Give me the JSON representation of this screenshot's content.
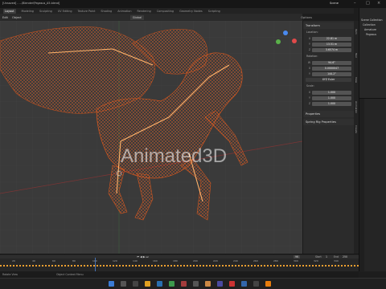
{
  "titlebar": {
    "filename": "[Unsaved] - ...\\Blender\\Pegasus_A5.blend]",
    "scene": "Scene"
  },
  "tabs": [
    "Layout",
    "Modeling",
    "Sculpting",
    "UV Editing",
    "Texture Paint",
    "Shading",
    "Animation",
    "Rendering",
    "Compositing",
    "Geometry Nodes",
    "Scripting"
  ],
  "viewport_header": {
    "mode": "Edit",
    "menu_object": "Object",
    "orientation": "Global"
  },
  "watermark": "Animated3D",
  "npanel": {
    "section_transform": "Transform",
    "location_label": "Location:",
    "location": [
      {
        "axis": "X",
        "value": "22.81 m"
      },
      {
        "axis": "Y",
        "value": "13.51 m"
      },
      {
        "axis": "Z",
        "value": "3.6574 m"
      }
    ],
    "rotation_label": "Rotation:",
    "rotation": [
      {
        "axis": "W",
        "value": "94.6°"
      },
      {
        "axis": "X",
        "value": "0.0000047"
      },
      {
        "axis": "Y",
        "value": "144.2°"
      }
    ],
    "rotation_mode": "XYZ Euler",
    "scale_label": "Scale:",
    "scale": [
      {
        "axis": "X",
        "value": "1.000"
      },
      {
        "axis": "Y",
        "value": "1.000"
      },
      {
        "axis": "Z",
        "value": "1.000"
      }
    ],
    "section_properties": "Properties",
    "section_spring": "Spring Rig Properties"
  },
  "vtabs": [
    "Item",
    "Tool",
    "View",
    "Animation",
    "Create"
  ],
  "options_label": "Options",
  "outliner_items": [
    "Scene Collection",
    "Collection",
    "Armature",
    "Pegasus"
  ],
  "timeline": {
    "ticks": [
      "20",
      "40",
      "60",
      "80",
      "100",
      "120",
      "140",
      "160",
      "180",
      "200",
      "220",
      "240",
      "260",
      "280",
      "300",
      "320",
      "340"
    ],
    "current_frame": "96",
    "start_label": "Start",
    "start": "1",
    "end_label": "End",
    "end": "250"
  },
  "statusbar": {
    "left": "Rotate View",
    "middle": "Object Context Menu"
  },
  "colors": {
    "accent": "#ff5a1f",
    "frame": "#4772b3"
  }
}
